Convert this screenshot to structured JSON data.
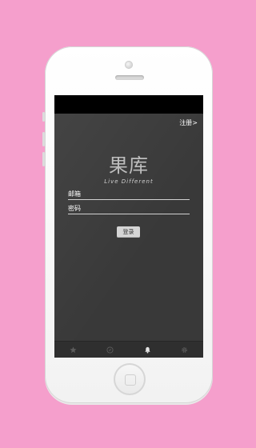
{
  "background_color": "#f59fcc",
  "screen": {
    "register_link": "注册>",
    "logo_text": "果库",
    "slogan": "Live Different",
    "email_label": "邮箱",
    "password_label": "密码",
    "login_button": "登录"
  },
  "tabbar": {
    "tabs": [
      {
        "icon": "star-icon",
        "active": false
      },
      {
        "icon": "compass-icon",
        "active": false
      },
      {
        "icon": "bell-icon",
        "active": true
      },
      {
        "icon": "gear-icon",
        "active": false
      }
    ]
  }
}
